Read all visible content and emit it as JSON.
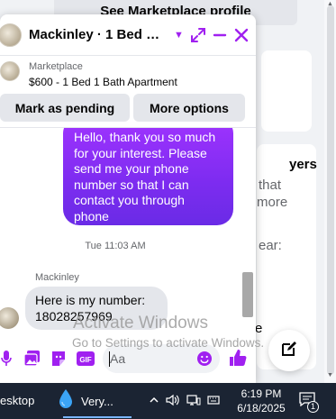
{
  "background": {
    "top_button_label": "See Marketplace profile",
    "heading_fragment": "yers",
    "text_fragment_1": "that",
    "text_fragment_2": "more",
    "text_fragment_3": "ear:",
    "text_fragment_4": "e"
  },
  "chat": {
    "title": "Mackinley · 1 Bed 1 Bath Apartment",
    "listing": {
      "source": "Marketplace",
      "title": "$600 - 1 Bed 1 Bath Apartment"
    },
    "actions": {
      "mark_pending": "Mark as pending",
      "more_options": "More options"
    },
    "messages": {
      "outgoing": "Hello, thank you so much for your interest. Please send me your phone number so that I can contact you through phone",
      "timestamp": "Tue 11:03 AM",
      "sender": "Mackinley",
      "incoming": "Here is my number: 18028257969"
    },
    "composer": {
      "placeholder": "Aa"
    },
    "accent_color": "#a020f0"
  },
  "watermark": {
    "title": "Activate Windows",
    "subtitle": "Go to Settings to activate Windows."
  },
  "taskbar": {
    "desktop_label": "esktop",
    "app_label": "Very...",
    "time": "6:19 PM",
    "date": "6/18/2025",
    "notification_count": "1"
  }
}
